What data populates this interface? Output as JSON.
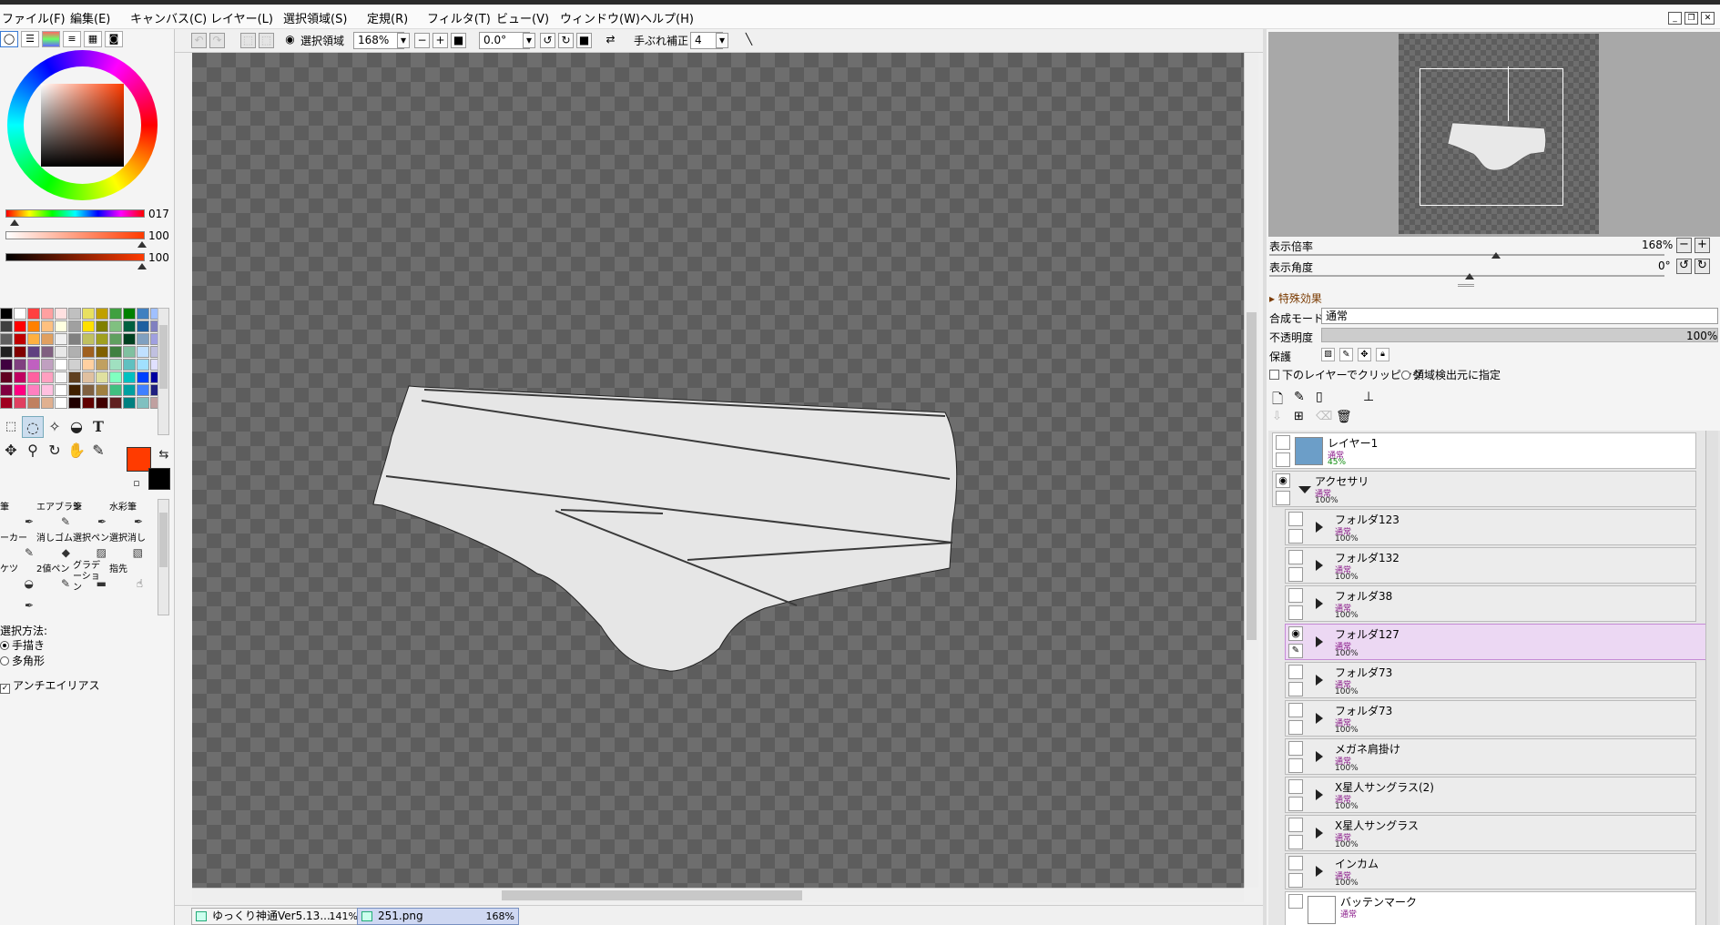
{
  "menu": [
    "ファイル(F)",
    "編集(E)",
    "キャンバス(C)",
    "レイヤー(L)",
    "選択領域(S)",
    "定規(R)",
    "フィルタ(T)",
    "ビュー(V)",
    "ウィンドウ(W)",
    "ヘルプ(H)"
  ],
  "color_panel": {
    "fg_color": "#ff3b00",
    "bg_color": "#000000",
    "h_value": "017",
    "s_value": "100",
    "v_value": "100"
  },
  "palette": [
    "#000000",
    "#ffffff",
    "#ff4040",
    "#ffa0a0",
    "#ffe0e0",
    "#c0c0c0",
    "#e8e060",
    "#c0a000",
    "#40a040",
    "#008000",
    "#4080c0",
    "#a0c0ff",
    "#404040",
    "#ff0000",
    "#ff8000",
    "#ffc080",
    "#ffffe0",
    "#a0a0a0",
    "#ffe000",
    "#808000",
    "#80c080",
    "#006040",
    "#2060a0",
    "#8080c0",
    "#606060",
    "#c00000",
    "#ffb040",
    "#e0a060",
    "#f0f0f0",
    "#808080",
    "#c0c060",
    "#a0a020",
    "#60a060",
    "#004020",
    "#80a0c0",
    "#a0a0e0",
    "#202020",
    "#800000",
    "#604080",
    "#806080",
    "#e8e8e8",
    "#b0b0b0",
    "#a06020",
    "#806000",
    "#408040",
    "#80c0a0",
    "#c0e0ff",
    "#c0c0e0",
    "#400040",
    "#804080",
    "#c060c0",
    "#c0a0c0",
    "#ffffff",
    "#d0d0d0",
    "#ffd0a0",
    "#c0a060",
    "#a0e0c0",
    "#60c0c0",
    "#a0e0ff",
    "#e0e0ff",
    "#600020",
    "#c00060",
    "#ff60a0",
    "#ffa0c0",
    "#f8f8f8",
    "#604020",
    "#e0c0a0",
    "#e0e0a0",
    "#80ffc0",
    "#00c0c0",
    "#0040ff",
    "#0000a0",
    "#800040",
    "#ff0080",
    "#ff80c0",
    "#ffc0e0",
    "#ffffff",
    "#402000",
    "#806040",
    "#a08040",
    "#40c080",
    "#00a0a0",
    "#4080ff",
    "#202080",
    "#a00020",
    "#e04060",
    "#c08060",
    "#e0b090",
    "#ffffff",
    "#200000",
    "#600000",
    "#400000",
    "#602020",
    "#008080",
    "#80c0c0",
    "#c0a0a0"
  ],
  "tools": {
    "text_tool": "T"
  },
  "brushes": [
    {
      "label": "筆"
    },
    {
      "label": "エアブラシ"
    },
    {
      "label": "筆"
    },
    {
      "label": "水彩筆"
    },
    {
      "label": "ーカー"
    },
    {
      "label": "消しゴム"
    },
    {
      "label": "選択ペン"
    },
    {
      "label": "選択消し"
    },
    {
      "label": "ケツ"
    },
    {
      "label": "2値ペン"
    },
    {
      "label": "グラデーション"
    },
    {
      "label": "指先"
    }
  ],
  "tool_options": {
    "method_label": "選択方法:",
    "method_options": [
      "手描き",
      "多角形"
    ],
    "antialias_label": "アンチエイリアス"
  },
  "toolbar": {
    "selection_label": "選択領域",
    "zoom": "168%",
    "rotation": "0.0°",
    "stabilizer_label": "手ぶれ補正",
    "stabilizer_value": "4"
  },
  "documents": [
    {
      "name": "ゆっくり神通Ver5.13....",
      "zoom": "141%"
    },
    {
      "name": "251.png",
      "zoom": "168%"
    }
  ],
  "navigator": {
    "zoom_label": "表示倍率",
    "zoom_value": "168%",
    "angle_label": "表示角度",
    "angle_value": "0°"
  },
  "layer_props": {
    "effects_label": "特殊効果",
    "blend_label": "合成モード",
    "blend_value": "通常",
    "opacity_label": "不透明度",
    "opacity_value": "100%",
    "protect_label": "保護",
    "clip_label": "下のレイヤーでクリッピング",
    "source_label": "領域検出元に指定"
  },
  "layers": [
    {
      "name": "レイヤー1",
      "mode": "通常",
      "opacity": "45%",
      "type": "layer"
    },
    {
      "name": "アクセサリ",
      "mode": "通常",
      "opacity": "100%",
      "type": "folder-open"
    },
    {
      "name": "フォルダ123",
      "mode": "通常",
      "opacity": "100%",
      "type": "folder"
    },
    {
      "name": "フォルダ132",
      "mode": "通常",
      "opacity": "100%",
      "type": "folder"
    },
    {
      "name": "フォルダ38",
      "mode": "通常",
      "opacity": "100%",
      "type": "folder"
    },
    {
      "name": "フォルダ127",
      "mode": "通常",
      "opacity": "100%",
      "type": "folder",
      "selected": true
    },
    {
      "name": "フォルダ73",
      "mode": "通常",
      "opacity": "100%",
      "type": "folder"
    },
    {
      "name": "フォルダ73",
      "mode": "通常",
      "opacity": "100%",
      "type": "folder"
    },
    {
      "name": "メガネ肩掛け",
      "mode": "通常",
      "opacity": "100%",
      "type": "folder"
    },
    {
      "name": "X星人サングラス(2)",
      "mode": "通常",
      "opacity": "100%",
      "type": "folder"
    },
    {
      "name": "X星人サングラス",
      "mode": "通常",
      "opacity": "100%",
      "type": "folder"
    },
    {
      "name": "インカム",
      "mode": "通常",
      "opacity": "100%",
      "type": "folder"
    },
    {
      "name": "バッテンマーク",
      "mode": "通常",
      "opacity": "",
      "type": "layer"
    }
  ]
}
